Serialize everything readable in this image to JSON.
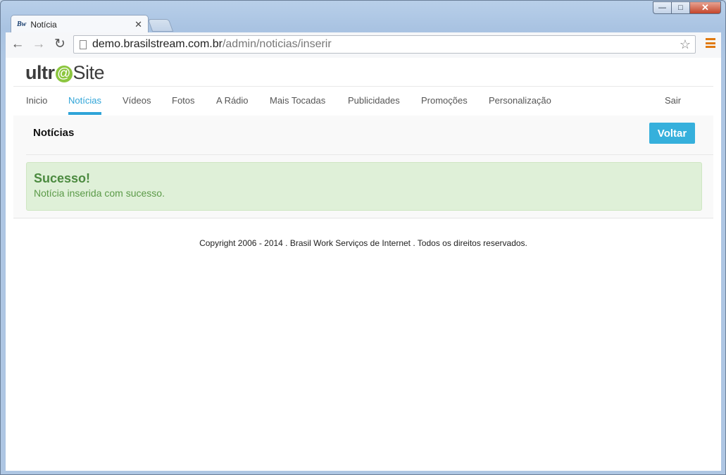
{
  "browser": {
    "tab_title": "Notícia",
    "tab_favicon": "Bw",
    "url_host": "demo.brasilstream.com.br",
    "url_path": "/admin/noticias/inserir"
  },
  "logo": {
    "part1": "ultr",
    "at": "@",
    "part2": "Site"
  },
  "nav": {
    "items": [
      "Inicio",
      "Notícias",
      "Vídeos",
      "Fotos",
      "A Rádio",
      "Mais Tocadas",
      "Publicidades",
      "Promoções",
      "Personalização"
    ],
    "active": "Notícias",
    "logout": "Sair"
  },
  "panel": {
    "title": "Notícias",
    "back_button": "Voltar"
  },
  "alert": {
    "title": "Sucesso!",
    "message": "Notícia inserida com sucesso."
  },
  "footer": {
    "copyright": "Copyright 2006 - 2014 . Brasil Work Serviços de Internet . Todos os direitos reservados."
  },
  "colors": {
    "accent": "#2fa4d8",
    "button": "#36b0dc",
    "success_bg": "#dff0d8",
    "success_text": "#4b8a3f",
    "logo_at": "#8cc63f"
  }
}
